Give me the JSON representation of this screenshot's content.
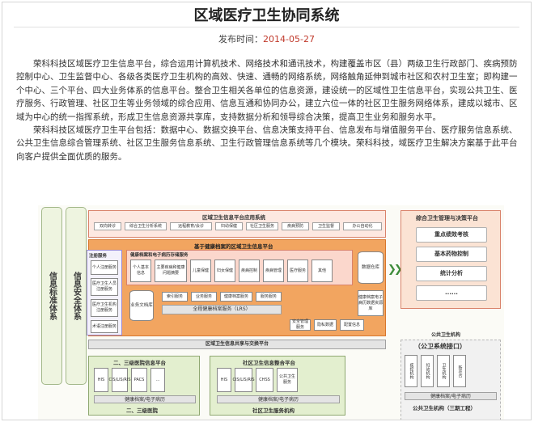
{
  "article": {
    "title": "区域医疗卫生协同系统",
    "meta_label": "发布时间：",
    "meta_date": "2014-05-27",
    "paragraphs": [
      "荣科科技区域医疗卫生信息平台，综合运用计算机技术、网络技术和通讯技术，构建覆盖市区（县）两级卫生行政部门、疾病预防控制中心、卫生监督中心、各级各类医疗卫生机构的高效、快速、通畅的网络系统，网络触角延伸到城市社区和农村卫生室；即构建一个中心、三个平台、四大业务体系的信息平台。整合卫生相关各单位的信息资源，建设统一的区域性卫生信息平台，实现公共卫生、医疗服务、行政管理、社区卫生等业务领域的综合应用、信息互通和协同办公，建立六位一体的社区卫生服务网络体系，建成以城市、区域为中心的统一指挥系统，形成卫生信息资源共享库，支持数据分析和领导综合决策，提高卫生业务和服务水平。",
      "荣科科技区域医疗卫生平台包括：数据中心、数据交换平台、信息决策支持平台、信息发布与增值服务平台、医疗服务信息系统、公共卫生信息综合管理系统、社区卫生服务信息系统、卫生行政管理信息系统等几个模块。荣科科技，域医疗卫生解决方案基于此平台向客户提供全面优质的服务。"
    ]
  },
  "diagram": {
    "left_bars": [
      "信息标准体系",
      "信息安全体系"
    ],
    "app_platform_title": "区域卫生信息平台应用系统",
    "app_items": [
      "双向转诊",
      "综合卫生分析系统",
      "远程教育/会诊",
      "妇幼保健",
      "社区卫生服务",
      "疾病预防",
      "卫生监督",
      "办公自动化"
    ],
    "data_platform_title": "基于健康档案的区域卫生信息平台",
    "reg_service": "注册服务",
    "reg_items": [
      "个人注册服务",
      "医疗卫生人员注册服务",
      "医疗卫生机构注册服务",
      "术语注册服务"
    ],
    "health_record_title": "健康档案和电子病历存储服务",
    "hr_items": [
      "个人基本信息",
      "主要疾病和健康问题摘要",
      "儿童保健",
      "妇女保健",
      "疾病控制",
      "疾病管理",
      "医疗服务",
      "其他"
    ],
    "cylinders": [
      "数据仓库",
      "业务文档库"
    ],
    "small_services": [
      "索引服务",
      "业务服务",
      "健康档案服务",
      "服务服务"
    ],
    "lrs": "全程健康档案服务（LRS）",
    "edr_box": "健康档案电子病历数据资源库",
    "sec_items": [
      "安全管理服务",
      "隐私数据",
      "配置信息"
    ],
    "share_bar": "区域卫生信息共享与交换平台",
    "hospital_platform": "二、三级医院信息平台",
    "hospital_items": [
      "HIS",
      "CIS/LIS/RIS",
      "PACS",
      "..."
    ],
    "hospital_bottom": "健康档案/电子病历",
    "hospital_label": "二、三级医院",
    "community_platform": "社区卫生信息整合平台",
    "community_items": [
      "HIS",
      "CIS/LIS/RIS",
      "CHSS",
      "公共卫生服务"
    ],
    "community_bottom": "健康档案/电子病历",
    "community_label": "社区卫生服务机构",
    "right_title": "综合卫生管理与决策平台",
    "right_items": [
      "重点绩效考核",
      "基本药物控制",
      "统计分析",
      "......"
    ],
    "public_health_label": "公共卫生机构",
    "public_interface": "（公卫系统接口）",
    "ph_items": [
      "疾控机构",
      "妇幼机构",
      "卫生机构",
      "新农合"
    ],
    "ph_bottom": "健康档案/电子病历",
    "ph_label": "公共卫生机构（三期工程）"
  }
}
